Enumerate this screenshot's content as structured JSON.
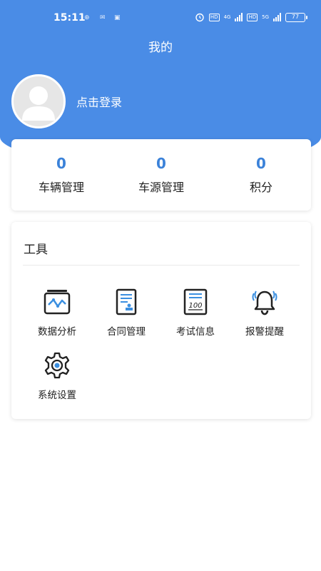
{
  "status_bar": {
    "time": "15:11",
    "left_icons": [
      "⊕",
      "✉",
      "▣"
    ],
    "hd1": "HD",
    "net1": "4G",
    "hd2": "HD",
    "net2": "5G",
    "battery": "77"
  },
  "header": {
    "title": "我的",
    "login_text": "点击登录"
  },
  "stats": [
    {
      "value": "0",
      "label": "车辆管理"
    },
    {
      "value": "0",
      "label": "车源管理"
    },
    {
      "value": "0",
      "label": "积分"
    }
  ],
  "tools": {
    "title": "工具",
    "items": [
      {
        "label": "数据分析",
        "icon": "data-analysis-icon"
      },
      {
        "label": "合同管理",
        "icon": "contract-icon"
      },
      {
        "label": "考试信息",
        "icon": "exam-icon"
      },
      {
        "label": "报警提醒",
        "icon": "bell-icon"
      },
      {
        "label": "系统设置",
        "icon": "gear-icon"
      }
    ]
  },
  "colors": {
    "primary": "#4a8ce6",
    "stat_value": "#3b82d9",
    "icon_accent": "#3b8fe0"
  }
}
